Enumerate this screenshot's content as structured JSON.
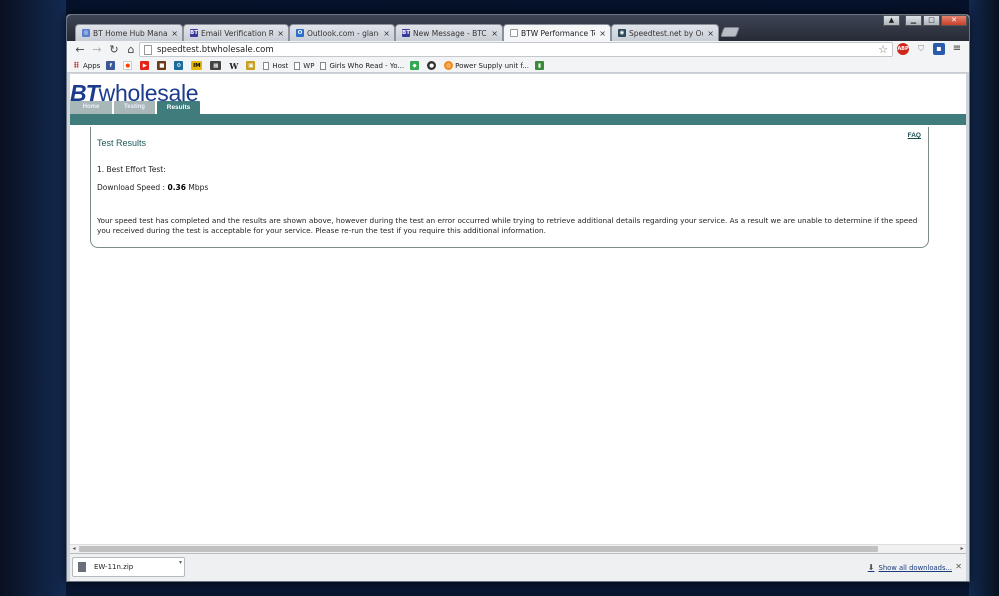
{
  "browser": {
    "tabs": [
      {
        "title": "BT Home Hub Manager - ",
        "favicon": "chrome-icon",
        "color": "#5a7fd0"
      },
      {
        "title": "Email Verification Require",
        "favicon": "bt-icon",
        "color": "#3a3a9a"
      },
      {
        "title": "Outlook.com - glane@ho",
        "favicon": "outlook-icon",
        "color": "#2a6fc9"
      },
      {
        "title": "New Message - BTCare C",
        "favicon": "bt-icon",
        "color": "#3a3a9a"
      },
      {
        "title": "BTW Performance Test",
        "favicon": "page-icon",
        "color": "#9a9a9a"
      },
      {
        "title": "Speedtest.net by Ookla - ",
        "favicon": "speedtest-icon",
        "color": "#2b4a5a"
      }
    ],
    "url": "speedtest.btwholesale.com",
    "bookmarks": [
      {
        "label": "Apps",
        "icon": "apps-grid-icon",
        "color": "#d23"
      },
      {
        "label": "",
        "icon": "facebook-icon",
        "color": "#3b5998"
      },
      {
        "label": "",
        "icon": "reddit-icon",
        "color": "#ff4500"
      },
      {
        "label": "",
        "icon": "youtube-icon",
        "color": "#e62117"
      },
      {
        "label": "",
        "icon": "briefcase-icon",
        "color": "#6b3a1a"
      },
      {
        "label": "",
        "icon": "gear-icon",
        "color": "#1b6b9b"
      },
      {
        "label": "",
        "icon": "imdb-icon",
        "color": "#e5b80b"
      },
      {
        "label": "",
        "icon": "film-icon",
        "color": "#444"
      },
      {
        "label": "W",
        "icon": "wikipedia-icon",
        "color": "#777"
      },
      {
        "label": "",
        "icon": "photo-icon",
        "color": "#c8a020"
      },
      {
        "label": "Host",
        "icon": "page-icon",
        "color": "#888"
      },
      {
        "label": "WP",
        "icon": "page-icon",
        "color": "#888"
      },
      {
        "label": "Girls Who Read - Yo...",
        "icon": "page-icon",
        "color": "#888"
      },
      {
        "label": "",
        "icon": "maps-icon",
        "color": "#34a853"
      },
      {
        "label": "",
        "icon": "dark-circle-icon",
        "color": "#333"
      },
      {
        "label": "Power Supply unit f...",
        "icon": "orange-circle-icon",
        "color": "#f28a1a"
      },
      {
        "label": "",
        "icon": "green-book-icon",
        "color": "#3a8a3a"
      }
    ]
  },
  "site": {
    "logo_bt": "BT",
    "logo_word": "wholesale",
    "nav": [
      "Home",
      "Testing",
      "Results"
    ],
    "faq": "FAQ",
    "title": "Test Results",
    "test_name": "1. Best Effort Test:",
    "download_label": "Download Speed : ",
    "download_value": "0.36",
    "download_unit": " Mbps",
    "message": "Your speed test has completed and the results are shown above, however during the test an error occurred while trying to retrieve additional details regarding your service. As a result we are unable to determine if the speed you received during the test is acceptable for your service. Please re-run the test if you require this additional information."
  },
  "downloads": {
    "file": "EW-11n.zip",
    "show_all": "Show all downloads..."
  }
}
